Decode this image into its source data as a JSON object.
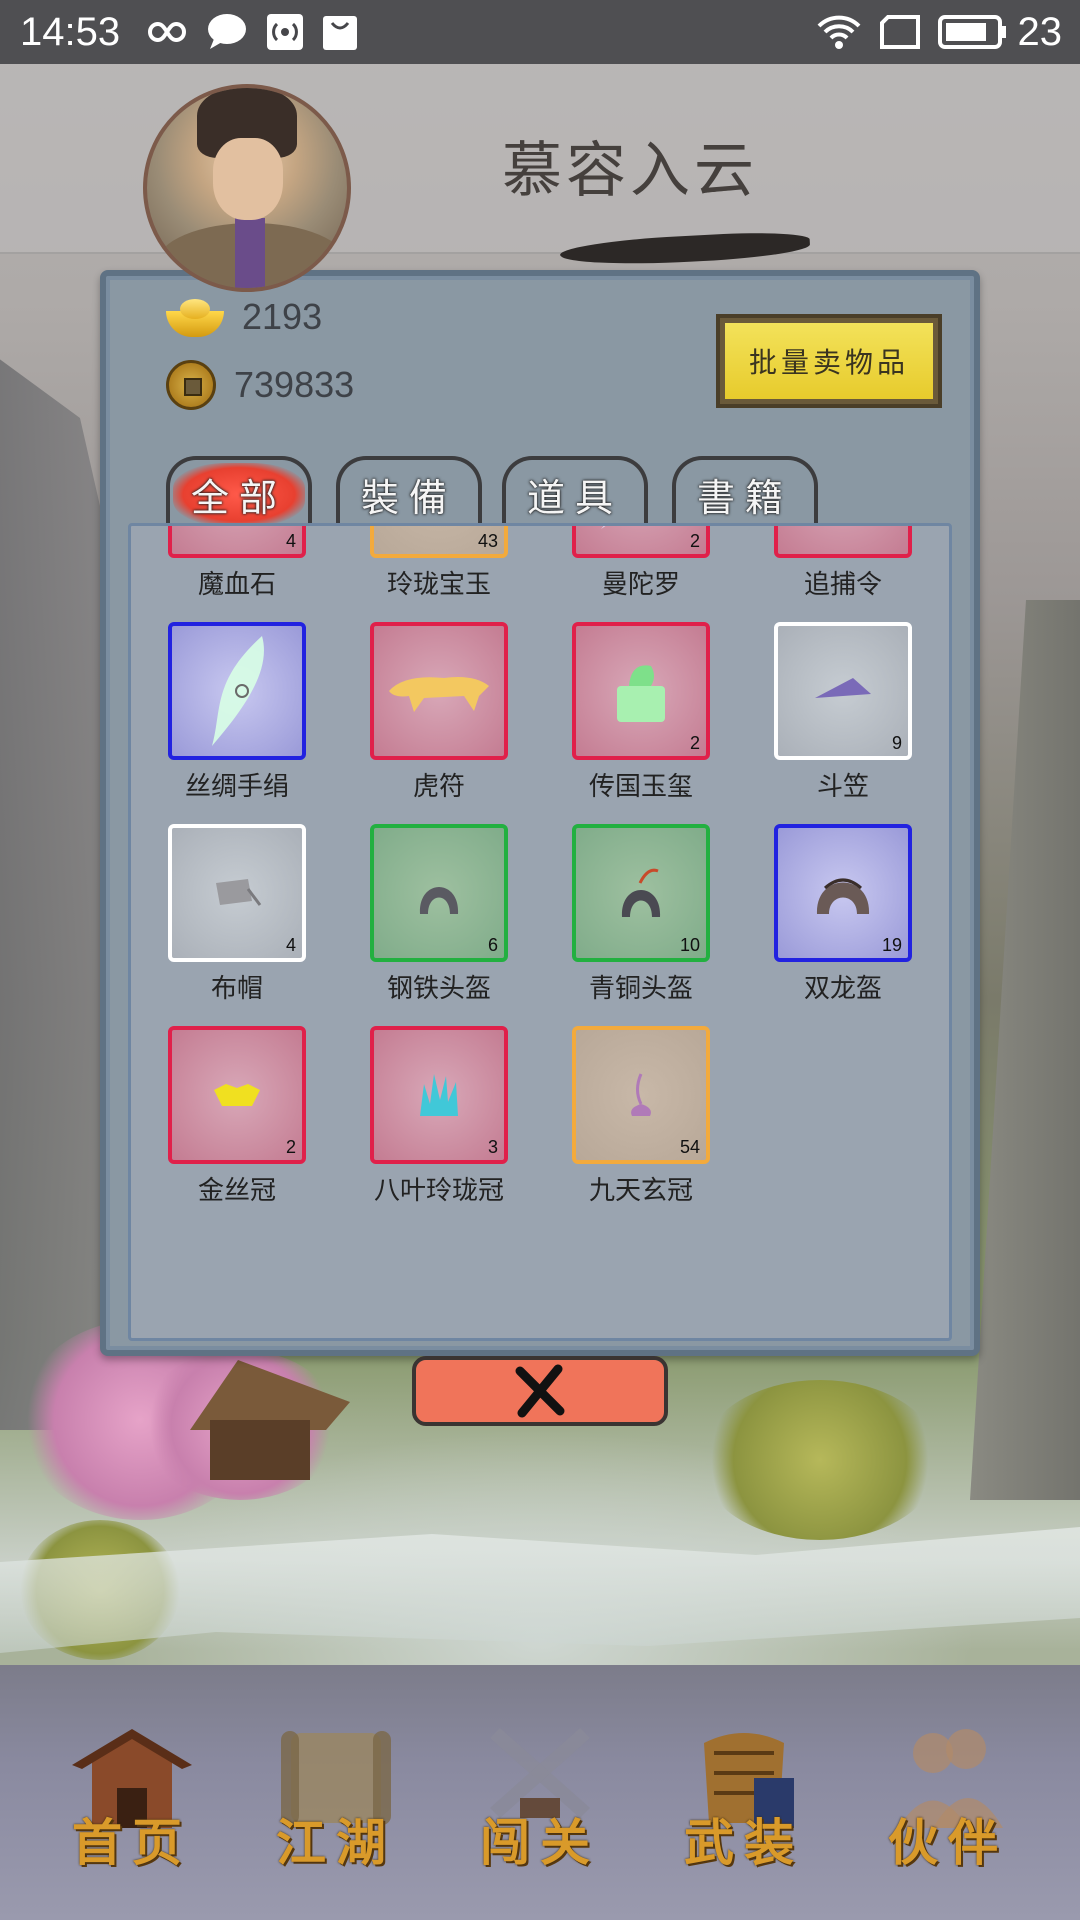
{
  "status_bar": {
    "time": "14:53",
    "battery": "23"
  },
  "header": {
    "player_name": "慕容入云"
  },
  "currency": {
    "gold_ingots": "2193",
    "coins": "739833"
  },
  "sell_button": "批量卖物品",
  "tabs": [
    {
      "label": "全部",
      "active": true
    },
    {
      "label": "裝備",
      "active": false
    },
    {
      "label": "道具",
      "active": false
    },
    {
      "label": "書籍",
      "active": false
    }
  ],
  "items": [
    {
      "name": "魔血石",
      "count": "4",
      "rarity": "red",
      "icon": "blood-stone-icon"
    },
    {
      "name": "玲珑宝玉",
      "count": "43",
      "rarity": "orange",
      "icon": "jade-icon"
    },
    {
      "name": "曼陀罗",
      "count": "2",
      "rarity": "red",
      "icon": "datura-flower-icon"
    },
    {
      "name": "追捕令",
      "count": "",
      "rarity": "red",
      "icon": "warrant-token-icon"
    },
    {
      "name": "丝绸手绢",
      "count": "",
      "rarity": "blue",
      "icon": "silk-handkerchief-icon"
    },
    {
      "name": "虎符",
      "count": "",
      "rarity": "red",
      "icon": "tiger-tally-icon"
    },
    {
      "name": "传国玉玺",
      "count": "2",
      "rarity": "red",
      "icon": "imperial-seal-icon"
    },
    {
      "name": "斗笠",
      "count": "9",
      "rarity": "white",
      "icon": "bamboo-hat-icon"
    },
    {
      "name": "布帽",
      "count": "4",
      "rarity": "white",
      "icon": "cloth-cap-icon"
    },
    {
      "name": "钢铁头盔",
      "count": "6",
      "rarity": "green",
      "icon": "steel-helmet-icon"
    },
    {
      "name": "青铜头盔",
      "count": "10",
      "rarity": "green",
      "icon": "bronze-helmet-icon"
    },
    {
      "name": "双龙盔",
      "count": "19",
      "rarity": "blue",
      "icon": "twin-dragon-helmet-icon"
    },
    {
      "name": "金丝冠",
      "count": "2",
      "rarity": "red",
      "icon": "gold-crown-icon"
    },
    {
      "name": "八叶玲珑冠",
      "count": "3",
      "rarity": "red",
      "icon": "eight-leaf-crown-icon"
    },
    {
      "name": "九天玄冠",
      "count": "54",
      "rarity": "orange",
      "icon": "nine-heaven-crown-icon"
    }
  ],
  "nav": [
    {
      "label": "首页",
      "icon": "house-icon"
    },
    {
      "label": "江湖",
      "icon": "scroll-icon"
    },
    {
      "label": "闯关",
      "icon": "crossed-swords-icon"
    },
    {
      "label": "武装",
      "icon": "armor-icon"
    },
    {
      "label": "伙伴",
      "icon": "companions-icon"
    }
  ],
  "colors": {
    "red_rarity": "#e0204a",
    "orange_rarity": "#f3aa3c",
    "blue_rarity": "#2222e0",
    "white_rarity": "#ffffff",
    "green_rarity": "#22b040",
    "sell_button": "#e7cb2c",
    "close_button": "#f0745a",
    "nav_label": "#d99a2a"
  }
}
